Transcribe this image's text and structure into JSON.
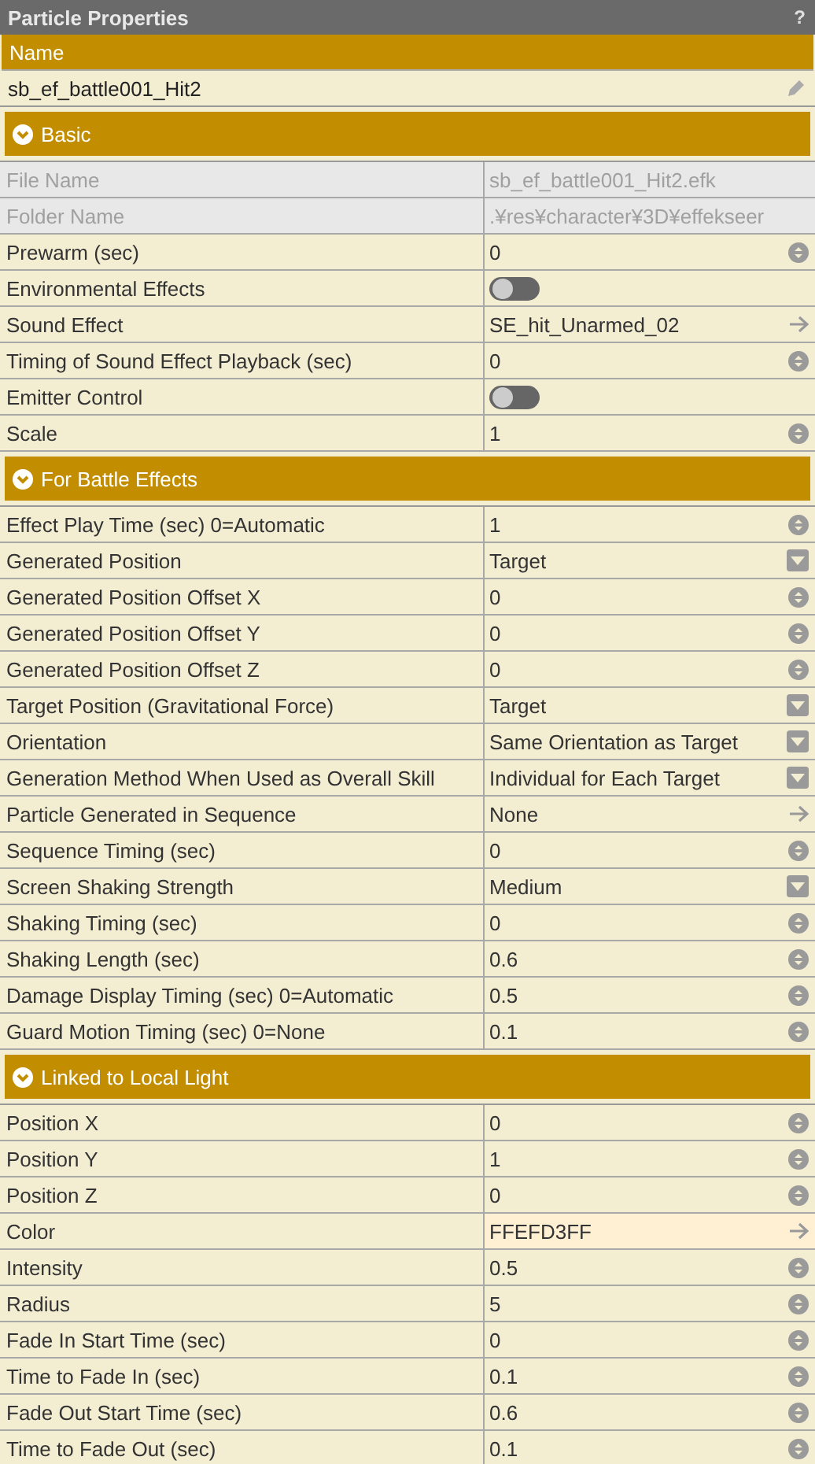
{
  "panel": {
    "title": "Particle Properties",
    "help": "?"
  },
  "name_field": {
    "label": "Name",
    "value": "sb_ef_battle001_Hit2"
  },
  "sections": [
    {
      "title": "Basic",
      "expanded": true,
      "rows": [
        {
          "kind": "readonly",
          "label": "File Name",
          "value": "sb_ef_battle001_Hit2.efk"
        },
        {
          "kind": "readonly",
          "label": "Folder Name",
          "value": ".¥res¥character¥3D¥effekseer"
        },
        {
          "kind": "number",
          "label": "Prewarm (sec)",
          "value": "0"
        },
        {
          "kind": "toggle",
          "label": "Environmental Effects",
          "on": false
        },
        {
          "kind": "link",
          "label": "Sound Effect",
          "value": "SE_hit_Unarmed_02"
        },
        {
          "kind": "number",
          "label": "Timing of Sound Effect Playback (sec)",
          "value": "0"
        },
        {
          "kind": "toggle",
          "label": "Emitter Control",
          "on": false
        },
        {
          "kind": "number",
          "label": "Scale",
          "value": "1"
        }
      ]
    },
    {
      "title": "For Battle Effects",
      "expanded": true,
      "rows": [
        {
          "kind": "number",
          "label": "Effect Play Time (sec) 0=Automatic",
          "value": "1"
        },
        {
          "kind": "select",
          "label": "Generated Position",
          "value": "Target"
        },
        {
          "kind": "number",
          "label": "Generated Position Offset X",
          "value": "0"
        },
        {
          "kind": "number",
          "label": "Generated Position Offset Y",
          "value": "0"
        },
        {
          "kind": "number",
          "label": "Generated Position Offset Z",
          "value": "0"
        },
        {
          "kind": "select",
          "label": "Target Position (Gravitational Force)",
          "value": "Target"
        },
        {
          "kind": "select",
          "label": "Orientation",
          "value": "Same Orientation as Target"
        },
        {
          "kind": "select",
          "label": "Generation Method When Used as Overall Skill",
          "value": "Individual for Each Target"
        },
        {
          "kind": "link",
          "label": "Particle Generated in Sequence",
          "value": "None"
        },
        {
          "kind": "number",
          "label": "Sequence Timing (sec)",
          "value": "0"
        },
        {
          "kind": "select",
          "label": "Screen Shaking Strength",
          "value": "Medium"
        },
        {
          "kind": "number",
          "label": "Shaking Timing (sec)",
          "value": "0"
        },
        {
          "kind": "number",
          "label": "Shaking Length (sec)",
          "value": "0.6"
        },
        {
          "kind": "number",
          "label": "Damage Display Timing (sec) 0=Automatic",
          "value": "0.5"
        },
        {
          "kind": "number",
          "label": "Guard Motion Timing (sec) 0=None",
          "value": "0.1"
        }
      ]
    },
    {
      "title": "Linked to Local Light",
      "expanded": true,
      "rows": [
        {
          "kind": "number",
          "label": "Position X",
          "value": "0"
        },
        {
          "kind": "number",
          "label": "Position Y",
          "value": "1"
        },
        {
          "kind": "number",
          "label": "Position Z",
          "value": "0"
        },
        {
          "kind": "color",
          "label": "Color",
          "value": "FFEFD3FF",
          "color": "#ffefd3"
        },
        {
          "kind": "number",
          "label": "Intensity",
          "value": "0.5"
        },
        {
          "kind": "number",
          "label": "Radius",
          "value": "5"
        },
        {
          "kind": "number",
          "label": "Fade In Start Time (sec)",
          "value": "0"
        },
        {
          "kind": "number",
          "label": "Time to Fade In (sec)",
          "value": "0.1"
        },
        {
          "kind": "number",
          "label": "Fade Out Start Time (sec)",
          "value": "0.6"
        },
        {
          "kind": "number",
          "label": "Time to Fade Out (sec)",
          "value": "0.1"
        }
      ]
    }
  ]
}
